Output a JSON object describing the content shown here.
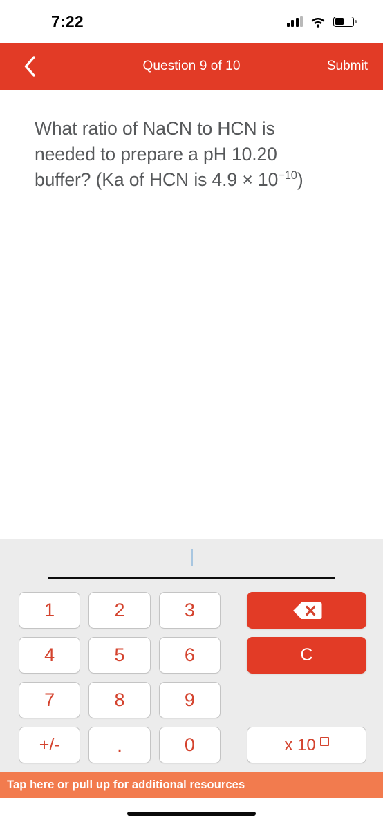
{
  "status_bar": {
    "time": "7:22",
    "signal_icon": "cellular-signal-icon",
    "wifi_icon": "wifi-icon",
    "battery_icon": "battery-icon"
  },
  "header": {
    "back_icon": "back-chevron-icon",
    "title": "Question 9 of 10",
    "submit_label": "Submit",
    "background_color": "#e23b26"
  },
  "question": {
    "line1": "What ratio of NaCN to HCN is",
    "line2": "needed to prepare a pH 10.20",
    "line3_prefix": "buffer? (Ka of HCN is 4.9 × 10",
    "line3_exponent": "−10",
    "line3_suffix": ")",
    "full_text": "What ratio of NaCN to HCN is needed to prepare a pH 10.20 buffer? (Ka of HCN is 4.9 × 10⁻¹⁰)"
  },
  "answer_input": {
    "value": "",
    "placeholder": "",
    "caret_visible": true
  },
  "keypad": {
    "digits": [
      "1",
      "2",
      "3",
      "4",
      "5",
      "6",
      "7",
      "8",
      "9"
    ],
    "sign_label": "+/-",
    "decimal_label": ".",
    "zero_label": "0",
    "backspace_icon": "backspace-delete-icon",
    "clear_label": "C",
    "exponent_label": "x 10",
    "exponent_box_icon": "exponent-placeholder-box-icon",
    "key_text_color": "#d4432e",
    "action_key_color": "#e23b26"
  },
  "resources_bar": {
    "label": "Tap here or pull up for additional resources",
    "background_color": "#f27b4e"
  },
  "home_indicator": {
    "name": "home-indicator"
  }
}
